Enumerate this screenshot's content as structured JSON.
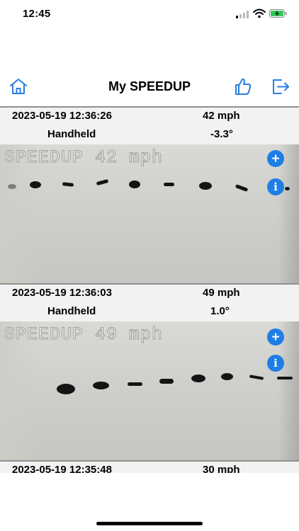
{
  "status_bar": {
    "time": "12:45"
  },
  "nav": {
    "title": "My SPEEDUP"
  },
  "entries": [
    {
      "timestamp": "2023-05-19 12:36:26",
      "speed": "42 mph",
      "mode": "Handheld",
      "angle": "-3.3°",
      "overlay": "SPEEDUP 42 mph"
    },
    {
      "timestamp": "2023-05-19 12:36:03",
      "speed": "49 mph",
      "mode": "Handheld",
      "angle": "1.0°",
      "overlay": "SPEEDUP 49 mph"
    },
    {
      "timestamp": "2023-05-19 12:35:48",
      "speed": "30 mph"
    }
  ],
  "colors": {
    "accent": "#2a7de1",
    "button": "#1e7ee6"
  },
  "icons": {
    "home": "home-icon",
    "like": "thumbs-up-icon",
    "exit": "logout-icon",
    "add": "plus-icon",
    "info": "info-icon"
  }
}
